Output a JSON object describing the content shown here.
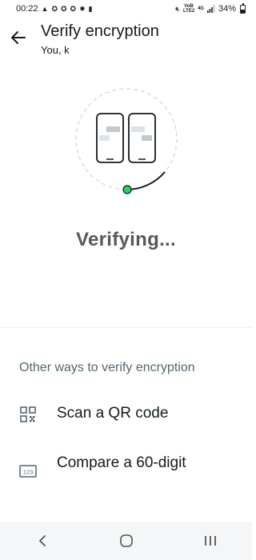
{
  "status_bar": {
    "time": "00:22",
    "network_top": "VoB LTE2",
    "network_type": "4G",
    "battery": "34%"
  },
  "header": {
    "title": "Verify encryption",
    "subtitle": "You, k"
  },
  "main": {
    "status_text": "Verifying..."
  },
  "other_ways": {
    "title": "Other ways to verify encryption",
    "options": [
      {
        "label": "Scan a QR code",
        "icon": "qr-code-icon"
      },
      {
        "label": "Compare a 60-digit",
        "icon": "number-123-icon",
        "icon_text": "123"
      }
    ]
  },
  "colors": {
    "accent_green": "#25d366",
    "text_primary": "#111b21",
    "text_secondary": "#54656f",
    "verifying_text": "#54595e"
  }
}
